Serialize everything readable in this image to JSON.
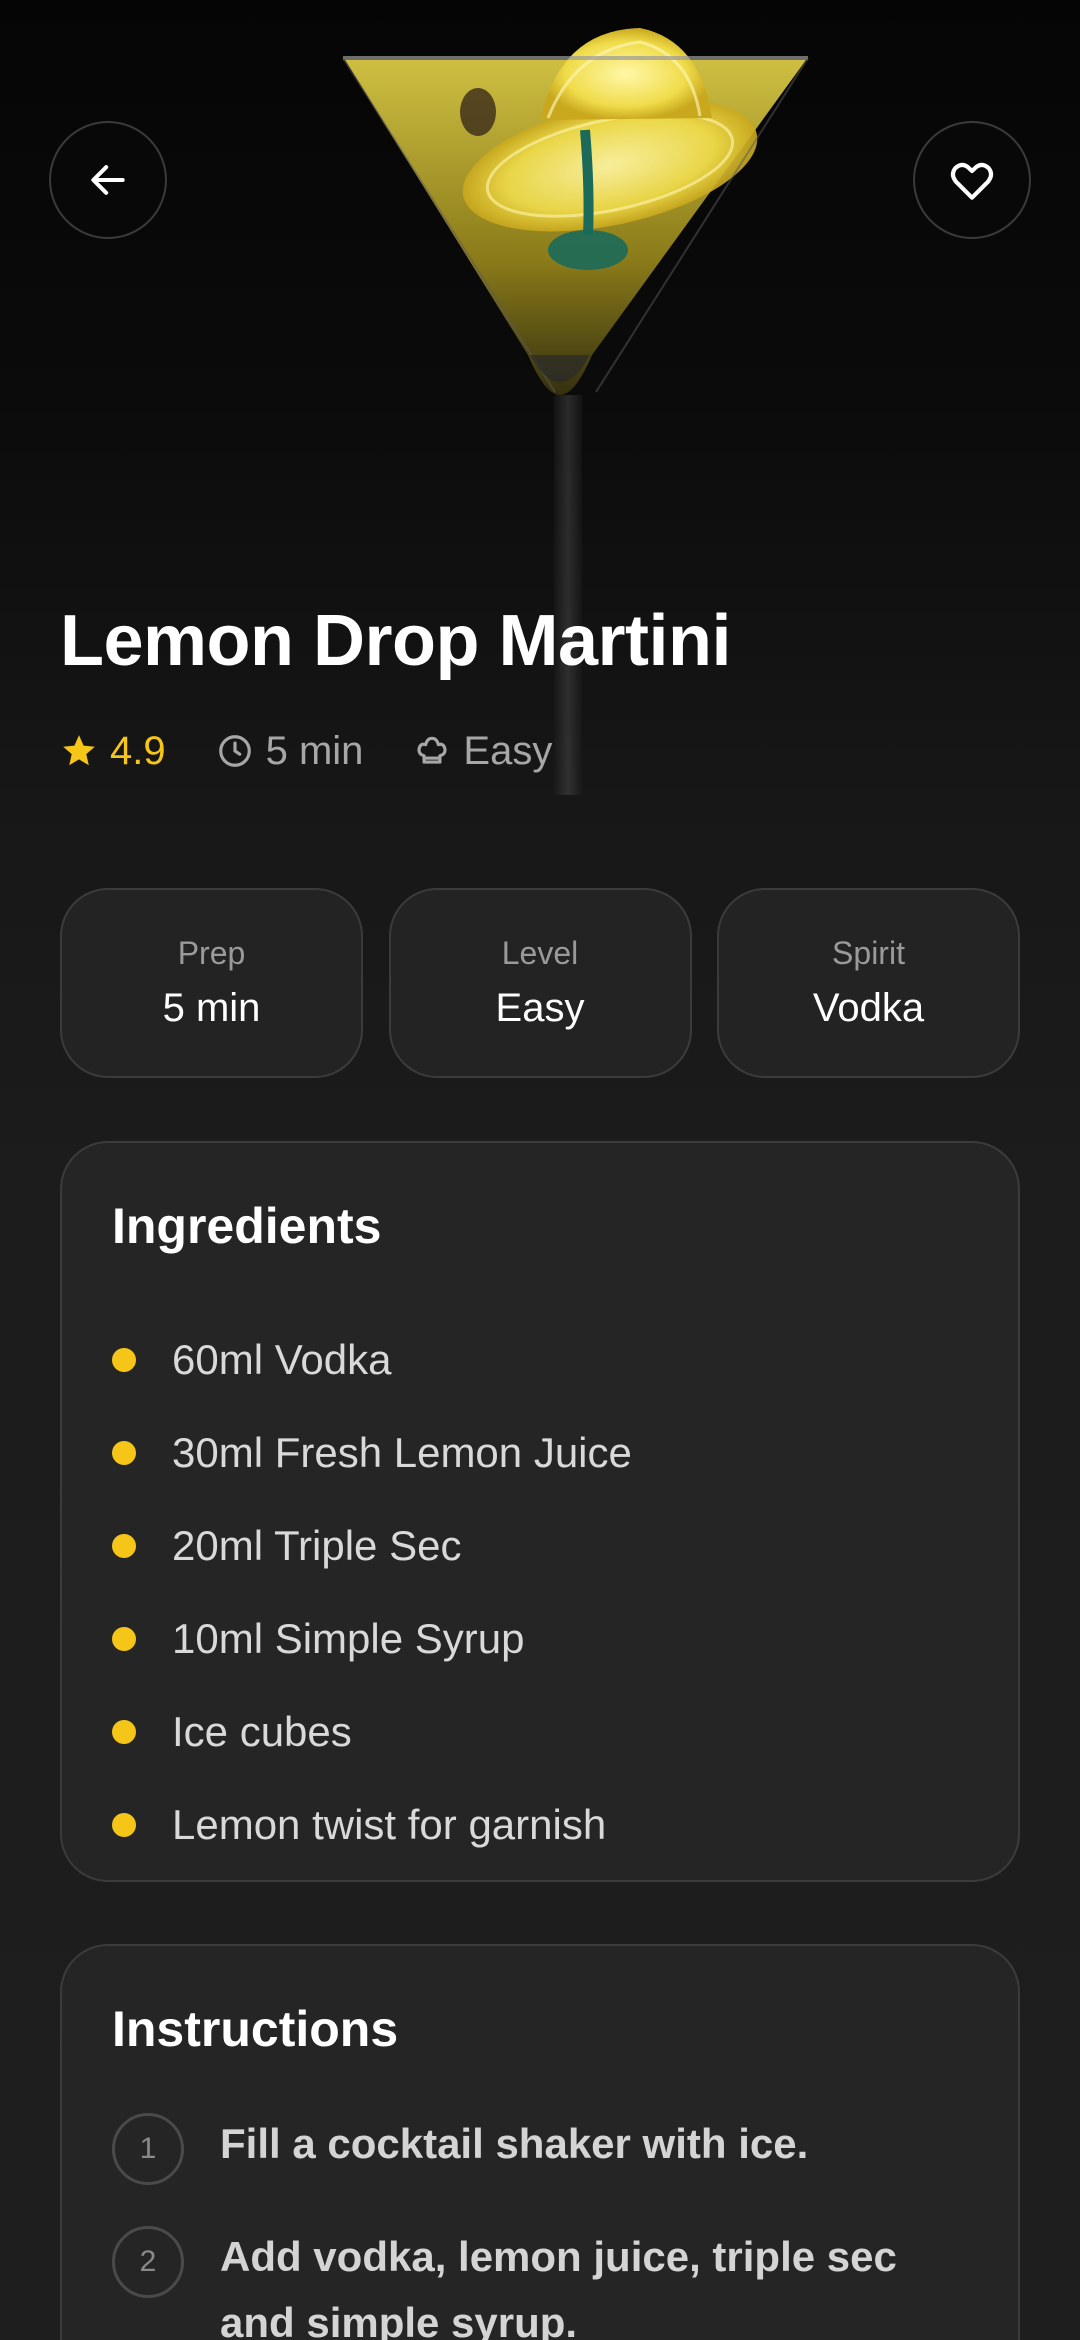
{
  "recipe": {
    "title": "Lemon Drop Martini",
    "rating": "4.9",
    "time": "5 min",
    "difficulty": "Easy"
  },
  "stats": [
    {
      "label": "Prep",
      "value": "5 min"
    },
    {
      "label": "Level",
      "value": "Easy"
    },
    {
      "label": "Spirit",
      "value": "Vodka"
    }
  ],
  "ingredients": {
    "title": "Ingredients",
    "items": [
      "60ml Vodka",
      "30ml Fresh Lemon Juice",
      "20ml Triple Sec",
      "10ml Simple Syrup",
      "Ice cubes",
      "Lemon twist for garnish"
    ]
  },
  "instructions": {
    "title": "Instructions",
    "steps": [
      {
        "num": "1",
        "text": "Fill a cocktail shaker with ice."
      },
      {
        "num": "2",
        "text": "Add vodka, lemon juice, triple sec and simple syrup."
      }
    ]
  },
  "icons": {
    "back": "arrow-left-icon",
    "favorite": "heart-icon",
    "rating": "star-icon",
    "time": "clock-icon",
    "difficulty": "chef-hat-icon"
  },
  "colors": {
    "accent": "#f5c518",
    "background": "#1b1b1b",
    "card": "#252525",
    "border": "#3b3b3b"
  }
}
